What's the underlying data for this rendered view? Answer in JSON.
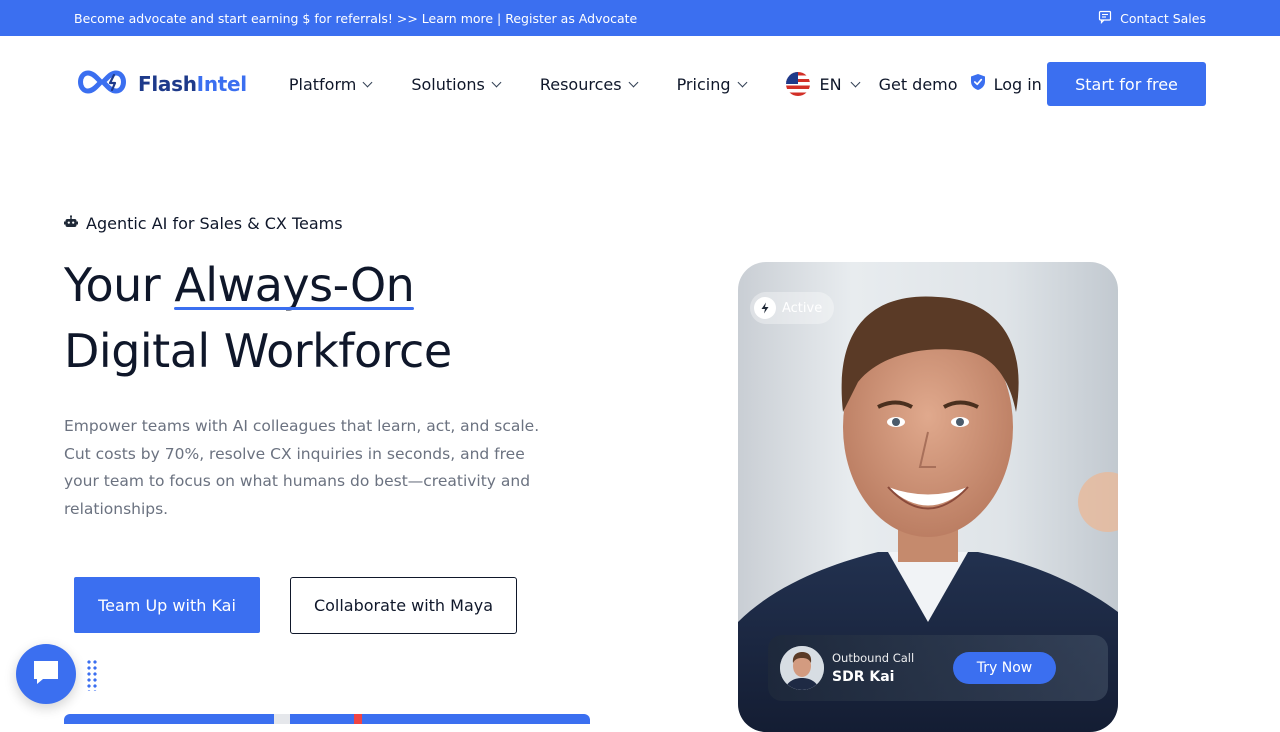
{
  "topbar": {
    "announcement": "Become advocate and start earning $ for referrals! >> Learn more | Register as Advocate",
    "contact_label": "Contact Sales"
  },
  "brand": {
    "name_part1": "Flash",
    "name_part2": "Intel",
    "accent_color": "#3b6ff0",
    "dark_color": "#1e3a8a"
  },
  "nav": {
    "items": [
      {
        "label": "Platform"
      },
      {
        "label": "Solutions"
      },
      {
        "label": "Resources"
      },
      {
        "label": "Pricing"
      }
    ],
    "language": "EN",
    "get_demo": "Get demo",
    "login": "Log in",
    "start_free": "Start for free"
  },
  "hero": {
    "eyebrow": "Agentic AI for Sales & CX Teams",
    "headline_prefix": "Your ",
    "headline_accent": "Always-On",
    "headline_line2": "Digital Workforce",
    "subtext": "Empower teams with AI colleagues that learn, act, and scale. Cut costs by 70%, resolve CX inquiries in seconds, and free your team to focus on what humans do best—creativity and relationships.",
    "cta_primary": "Team Up with Kai",
    "cta_secondary": "Collaborate with Maya"
  },
  "agent_card": {
    "status": "Active",
    "call_type": "Outbound Call",
    "agent_name": "SDR Kai",
    "try_label": "Try Now"
  },
  "icons": {
    "chat": "chat-bubble-icon",
    "contact": "message-square-icon",
    "robot": "robot-icon",
    "shield": "shield-icon",
    "bolt": "lightning-bolt-icon",
    "flag": "us-flag-icon"
  }
}
